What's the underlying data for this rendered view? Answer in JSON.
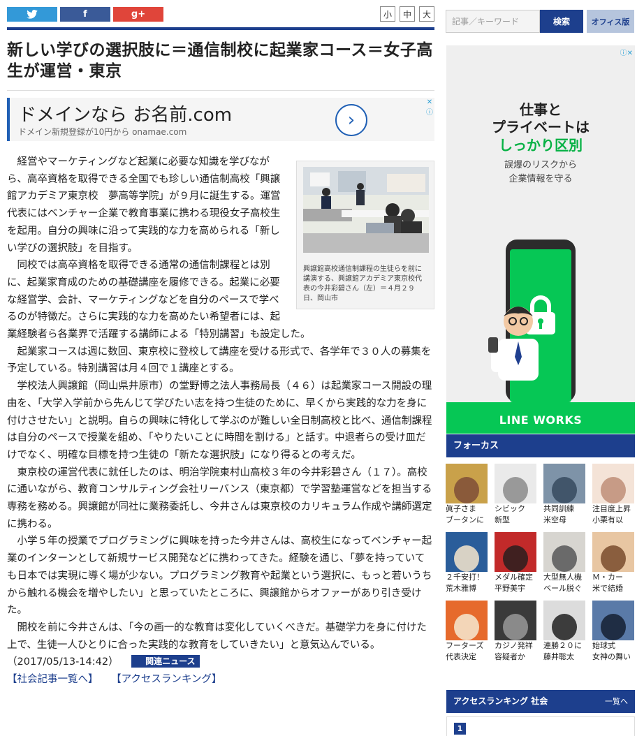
{
  "share": {
    "twitter_icon": "twitter-bird-icon",
    "facebook_label": "f",
    "gplus_label": "g+"
  },
  "font_size": {
    "small": "小",
    "medium": "中",
    "large": "大"
  },
  "article": {
    "title": "新しい学びの選択肢に＝通信制校に起業家コース＝女子高生が運営・東京",
    "paragraphs": [
      "経営やマーケティングなど起業に必要な知識を学びながら、高卒資格を取得できる全国でも珍しい通信制高校「興譲館アカデミア東京校　夢高等学院」が９月に誕生する。運営代表にはベンチャー企業で教育事業に携わる現役女子高校生を起用。自分の興味に沿って実践的な力を高められる「新しい学びの選択肢」を目指す。",
      "同校では高卒資格を取得できる通常の通信制課程とは別に、起業家育成のための基礎講座を履修できる。起業に必要な経営学、会計、マーケティングなどを自分のペースで学べるのが特徴だ。さらに実践的な力を高めたい希望者には、起業経験者ら各業界で活躍する講師による「特別講習」も設定した。",
      "起業家コースは週に数回、東京校に登校して講座を受ける形式で、各学年で３０人の募集を予定している。特別講習は月４回で１講座とする。",
      "学校法人興譲館（岡山県井原市）の堂野博之法人事務局長（４６）は起業家コース開設の理由を、「大学入学前から先んじて学びたい志を持つ生徒のために、早くから実践的な力を身に付けさせたい」と説明。自らの興味に特化して学ぶのが難しい全日制高校と比べ、通信制課程は自分のペースで授業を組め、「やりたいことに時間を割ける」と話す。中退者らの受け皿だけでなく、明確な目標を持つ生徒の「新たな選択肢」になり得るとの考えだ。",
      "東京校の運営代表に就任したのは、明治学院東村山高校３年の今井彩碧さん（１７）。高校に通いながら、教育コンサルティング会社リーバンス（東京都）で学習塾運営などを担当する専務を務める。興譲館が同社に業務委託し、今井さんは東京校のカリキュラム作成や講師選定に携わる。",
      "小学５年の授業でプログラミングに興味を持った今井さんは、高校生になってベンチャー起業のインターンとして新規サービス開発などに携わってきた。経験を通じ、「夢を持っていても日本では実現に導く場が少ない。プログラミング教育や起業という選択に、もっと若いうちから触れる機会を増やしたい」と思っていたところに、興譲館からオファーがあり引き受けた。",
      "開校を前に今井さんは、「今の画一的な教育は変化していくべきだ。基礎学力を身に付けた上で、生徒一人ひとりに合った実践的な教育をしていきたい」と意気込んでいる。"
    ],
    "dateline": "（2017/05/13-14:42）",
    "related_label": "関連ニュース",
    "photo_caption": "興譲館高校通信制課程の生徒らを前に講演する、興譲館アカデミア東京校代表の今井彩碧さん（左）＝４月２９日、岡山市",
    "links": [
      "【社会記事一覧へ】",
      "【アクセスランキング】"
    ]
  },
  "ad_banner": {
    "headline": "ドメインなら お名前.com",
    "sub": "ドメイン新規登録が10円から onamae.com",
    "close": "✕",
    "info": "ⓘ"
  },
  "search": {
    "placeholder": "記事／キーワード",
    "button": "検索",
    "office": "オフィス版"
  },
  "side_ad": {
    "line1": "仕事と",
    "line2": "プライベートは",
    "highlight": "しっかり区別",
    "sub1": "誤爆のリスクから",
    "sub2": "企業情報を守る",
    "brand": "LINE WORKS",
    "info": "ⓘ✕"
  },
  "focus": {
    "heading": "フォーカス",
    "items": [
      {
        "l1": "眞子さま",
        "l2": "ブータンに",
        "c1": "#c9a14a",
        "c2": "#8a5a3a"
      },
      {
        "l1": "シビック",
        "l2": "新型",
        "c1": "#eaeaea",
        "c2": "#999999"
      },
      {
        "l1": "共同訓練",
        "l2": "米空母",
        "c1": "#7e93a8",
        "c2": "#41556a"
      },
      {
        "l1": "注目度上昇",
        "l2": "小栗有以",
        "c1": "#f4e3d7",
        "c2": "#c79b86"
      },
      {
        "l1": "２千安打！",
        "l2": "荒木雅博",
        "c1": "#2a5d9a",
        "c2": "#d8d2c5"
      },
      {
        "l1": "メダル確定",
        "l2": "平野美宇",
        "c1": "#c22a2a",
        "c2": "#402020"
      },
      {
        "l1": "大型無人機",
        "l2": "ベール脱ぐ",
        "c1": "#d7d5d0",
        "c2": "#6a6a6a"
      },
      {
        "l1": "Ｍ・カー",
        "l2": "米で結婚",
        "c1": "#e8c6a2",
        "c2": "#8a5e3e"
      },
      {
        "l1": "フーターズ",
        "l2": "代表決定",
        "c1": "#e66a2c",
        "c2": "#f3d6b8"
      },
      {
        "l1": "カジノ発祥",
        "l2": "容疑者か",
        "c1": "#3a3a3a",
        "c2": "#8a8a8a"
      },
      {
        "l1": "連勝２０に",
        "l2": "藤井聡太",
        "c1": "#dcdcdc",
        "c2": "#3c3c3c"
      },
      {
        "l1": "始球式",
        "l2": "女神の舞い",
        "c1": "#5a7aa8",
        "c2": "#1f2d44"
      }
    ]
  },
  "ranking": {
    "heading": "アクセスランキング 社会",
    "more": "一覧へ",
    "first_rank": "1"
  }
}
